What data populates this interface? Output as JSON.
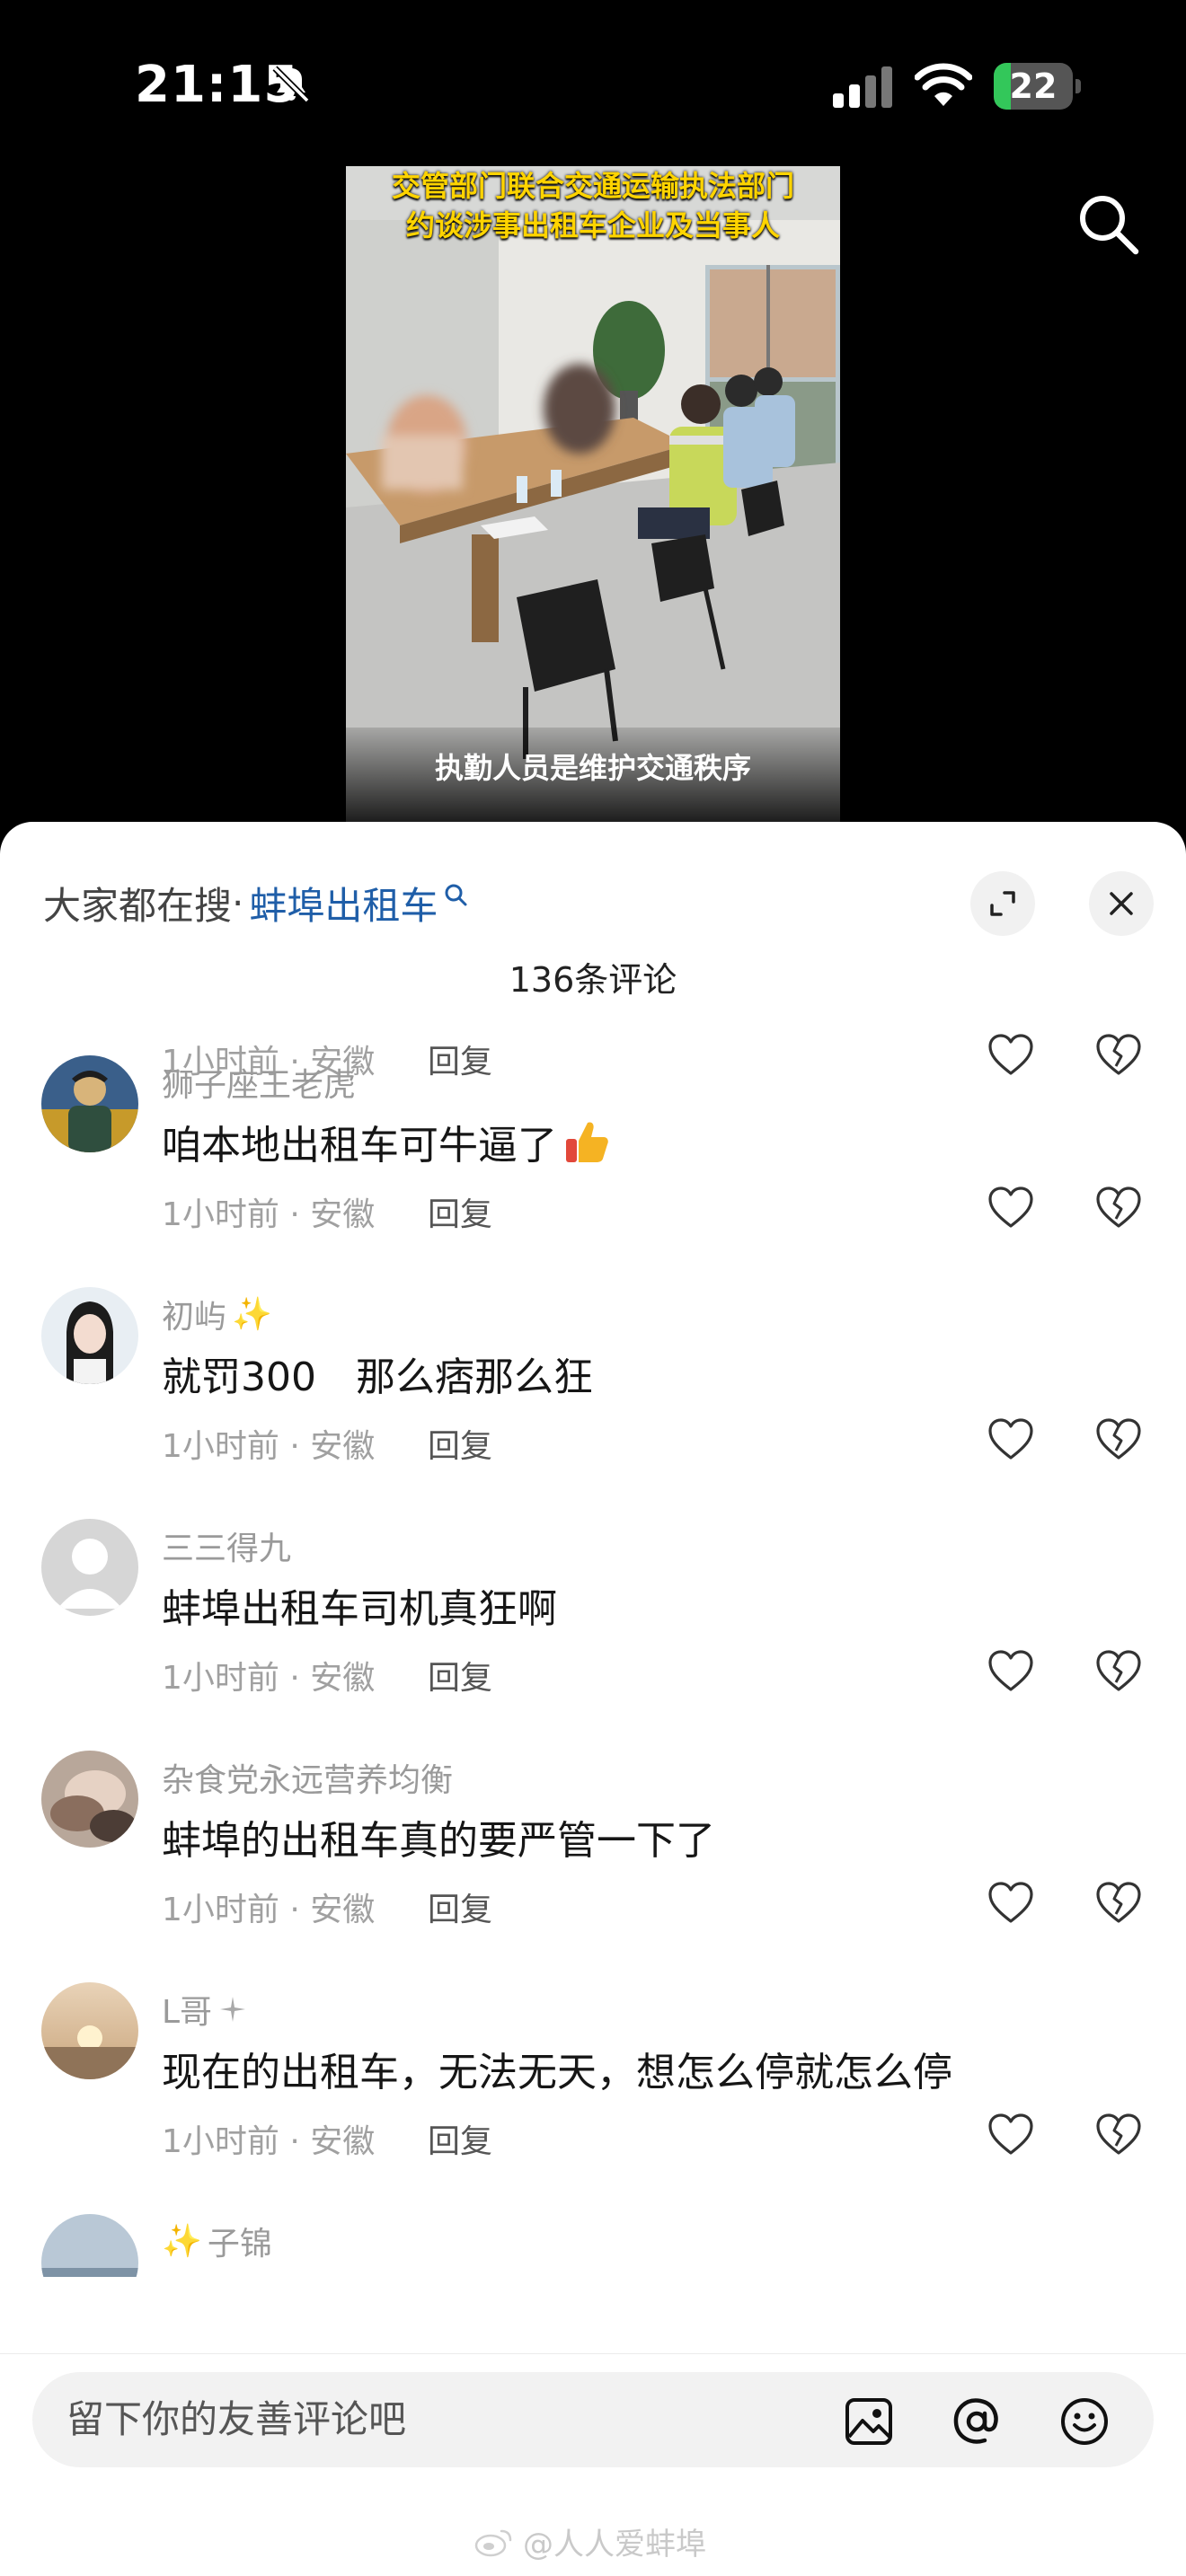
{
  "status_bar": {
    "time": "21:15",
    "battery_level": "22",
    "battery_fraction": 0.22
  },
  "video": {
    "title_line1": "交管部门联合交通运输执法部门",
    "title_line2": "约谈涉事出租车企业及当事人",
    "caption": "执勤人员是维护交通秩序"
  },
  "panel": {
    "search_prefix": "大家都在搜",
    "search_separator": "·",
    "search_term": "蚌埠出租车",
    "comment_count": "136条评论"
  },
  "comments": [
    {
      "meta": "1小时前 · 安徽",
      "reply": "回复"
    },
    {
      "name": "狮子座王老虎",
      "text": "咱本地出租车可牛逼了",
      "emoji": "thumbs-up",
      "meta": "1小时前 · 安徽",
      "reply": "回复"
    },
    {
      "name": "初屿",
      "name_suffix": "✨",
      "text": "就罚300　那么痞那么狂",
      "meta": "1小时前 · 安徽",
      "reply": "回复"
    },
    {
      "name": "三三得九",
      "text": "蚌埠出租车司机真狂啊",
      "meta": "1小时前 · 安徽",
      "reply": "回复"
    },
    {
      "name": "杂食党永远营养均衡",
      "text": "蚌埠的出租车真的要严管一下了",
      "meta": "1小时前 · 安徽",
      "reply": "回复"
    },
    {
      "name": "L哥",
      "text": "现在的出租车，无法无天，想怎么停就怎么停",
      "meta": "1小时前 · 安徽",
      "reply": "回复"
    },
    {
      "name": "子锦",
      "name_prefix": "✨"
    }
  ],
  "input": {
    "placeholder": "留下你的友善评论吧"
  },
  "watermark": "@人人爱蚌埠",
  "icons": [
    "bell-slash-icon",
    "cellular-signal-icon",
    "wifi-icon",
    "battery-icon",
    "search-icon",
    "expand-icon",
    "close-icon",
    "heart-icon",
    "broken-heart-icon",
    "image-icon",
    "at-icon",
    "emoji-icon",
    "weibo-icon"
  ]
}
